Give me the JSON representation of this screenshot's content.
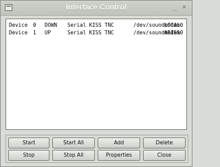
{
  "window": {
    "title": "Interface Control",
    "minimize_glyph": "_",
    "close_glyph": "×"
  },
  "devices": [
    {
      "label": "Device",
      "index": "0",
      "status": "DOWN",
      "type": "Serial KISS TNC",
      "port": "/dev/soundmodem0",
      "name": "LOCAL"
    },
    {
      "label": "Device",
      "index": "1",
      "status": "UP",
      "type": "Serial KISS TNC",
      "port": "/dev/soundmodem0",
      "name": "ARISS"
    }
  ],
  "buttons": {
    "start": "Start",
    "start_all": "Start All",
    "add": "Add",
    "delete": "Delete",
    "stop": "Stop",
    "stop_all": "Stop All",
    "properties": "Properties",
    "close": "Close"
  }
}
